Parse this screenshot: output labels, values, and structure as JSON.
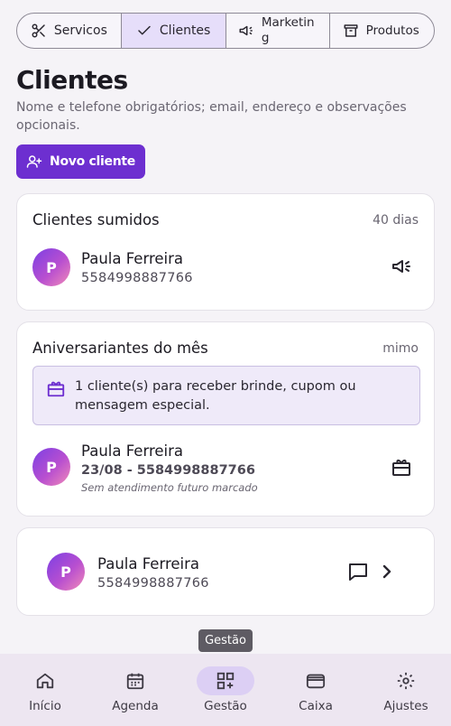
{
  "tabs": [
    {
      "label": "Servicos",
      "icon": "scissors-icon",
      "active": false
    },
    {
      "label": "Clientes",
      "icon": "check-icon",
      "active": true
    },
    {
      "label": "Marketing",
      "icon": "megaphone-icon",
      "active": false
    },
    {
      "label": "Produtos",
      "icon": "archive-icon",
      "active": false
    }
  ],
  "page": {
    "title": "Clientes",
    "subtitle": "Nome e telefone obrigatórios; email, endereço e observações opcionais.",
    "new_client_label": "Novo cliente"
  },
  "missing_clients": {
    "title": "Clientes sumidos",
    "meta": "40 dias",
    "client": {
      "initial": "P",
      "name": "Paula Ferreira",
      "phone": "5584998887766",
      "action_icon": "megaphone-icon"
    }
  },
  "birthdays": {
    "title": "Aniversariantes do mês",
    "meta": "mimo",
    "notice": "1 cliente(s) para receber brinde, cupom ou mensagem especial.",
    "notice_icon": "gift-icon",
    "client": {
      "initial": "P",
      "name": "Paula Ferreira",
      "detail": "23/08 - 5584998887766",
      "note": "Sem atendimento futuro marcado",
      "action_icon": "gift-icon"
    }
  },
  "client_list": {
    "client": {
      "initial": "P",
      "name": "Paula Ferreira",
      "phone": "5584998887766"
    },
    "icons": [
      "message-icon",
      "chevron-right-icon"
    ]
  },
  "tooltip": "Gestão",
  "bottom_nav": [
    {
      "label": "Início",
      "icon": "home-icon",
      "active": false
    },
    {
      "label": "Agenda",
      "icon": "calendar-icon",
      "active": false
    },
    {
      "label": "Gestão",
      "icon": "grid-plus-icon",
      "active": true
    },
    {
      "label": "Caixa",
      "icon": "wallet-icon",
      "active": false
    },
    {
      "label": "Ajustes",
      "icon": "gear-icon",
      "active": false
    }
  ],
  "colors": {
    "accent": "#6d2fd0",
    "active_tab_bg": "#e6defa",
    "nav_bg": "#ede6f1"
  }
}
